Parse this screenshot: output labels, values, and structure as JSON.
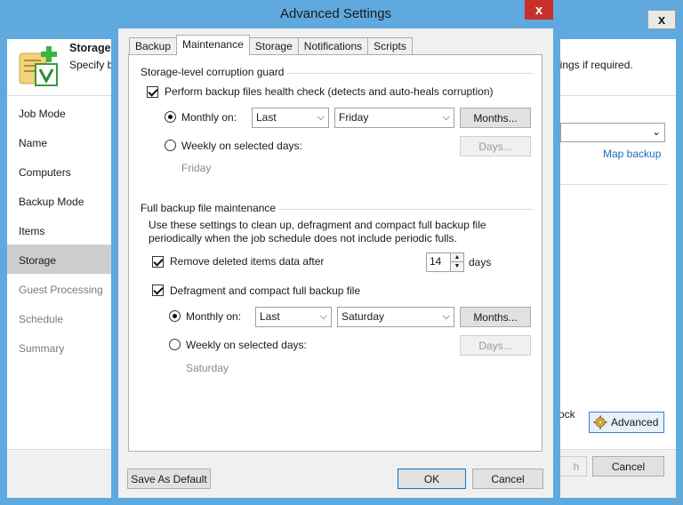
{
  "background_wizard": {
    "title": "Storage",
    "subtitle_left": "Specify b",
    "subtitle_right": "ttings if required.",
    "nav": [
      "Job Mode",
      "Name",
      "Computers",
      "Backup Mode",
      "Items",
      "Storage",
      "Guest Processing",
      "Schedule",
      "Summary"
    ],
    "active_nav": "Storage",
    "map_backup_link": "Map backup",
    "lock_fragment": "ock",
    "advanced_button": "Advanced",
    "finish_fragment": "h",
    "cancel_button": "Cancel",
    "close_glyph": "x"
  },
  "dialog": {
    "title": "Advanced Settings",
    "close_glyph": "x",
    "tabs": [
      "Backup",
      "Maintenance",
      "Storage",
      "Notifications",
      "Scripts"
    ],
    "active_tab": "Maintenance",
    "corruption_guard": {
      "group_title": "Storage-level corruption guard",
      "health_check_label": "Perform backup files health check (detects and auto-heals corruption)",
      "health_check_checked": true,
      "monthly_label": "Monthly on:",
      "monthly_selected": true,
      "monthly_week": "Last",
      "monthly_day": "Friday",
      "months_button": "Months...",
      "weekly_label": "Weekly on selected days:",
      "days_button": "Days...",
      "weekly_days_value": "Friday"
    },
    "full_backup_maintenance": {
      "group_title": "Full backup file maintenance",
      "description_line1": "Use these settings to clean up, defragment and compact full backup file",
      "description_line2": "periodically when the job schedule does not include periodic fulls.",
      "remove_deleted_label": "Remove deleted items data after",
      "remove_deleted_checked": true,
      "remove_deleted_value": "14",
      "remove_deleted_unit": "days",
      "defrag_label": "Defragment and compact full backup file",
      "defrag_checked": true,
      "monthly_label": "Monthly on:",
      "monthly_selected": true,
      "monthly_week": "Last",
      "monthly_day": "Saturday",
      "months_button": "Months...",
      "weekly_label": "Weekly on selected days:",
      "days_button": "Days...",
      "weekly_days_value": "Saturday"
    },
    "footer": {
      "save_default": "Save As Default",
      "ok": "OK",
      "cancel": "Cancel"
    }
  },
  "colors": {
    "window_border": "#5fa9df",
    "close_red": "#c7312a",
    "link_blue": "#1d6fb8",
    "nav_active": "#cdcdcd"
  }
}
